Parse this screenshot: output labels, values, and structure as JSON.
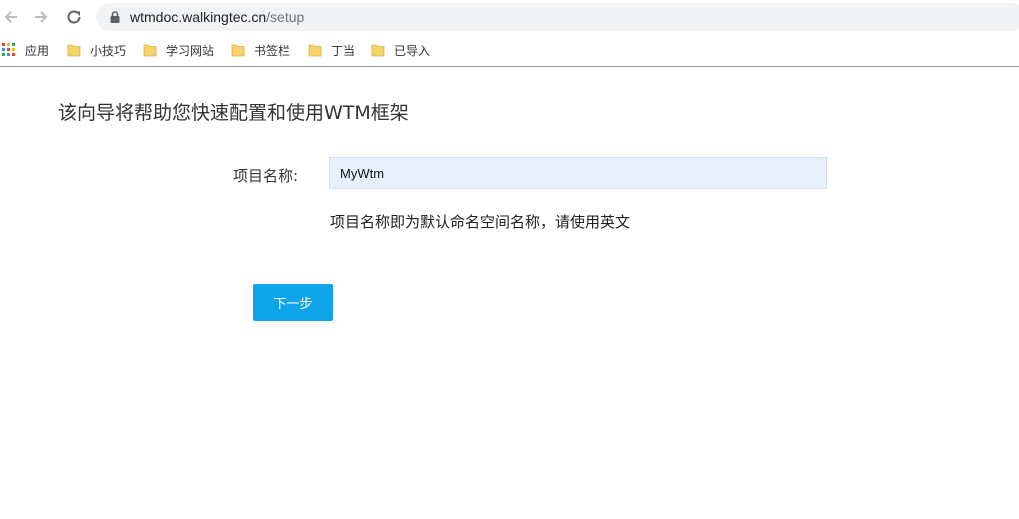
{
  "browser": {
    "url_host": "wtmdoc.walkingtec.cn",
    "url_path": "/setup",
    "bookmarks": [
      {
        "label": "应用",
        "icon": "apps-grid-icon"
      },
      {
        "label": "小技巧",
        "icon": "folder-icon"
      },
      {
        "label": "学习网站",
        "icon": "folder-icon"
      },
      {
        "label": "书签栏",
        "icon": "folder-icon"
      },
      {
        "label": "丁当",
        "icon": "folder-icon"
      },
      {
        "label": "已导入",
        "icon": "folder-icon"
      }
    ]
  },
  "setup": {
    "heading": "该向导将帮助您快速配置和使用WTM框架",
    "project_name_label": "项目名称:",
    "project_name_value": "MyWtm",
    "hint": "项目名称即为默认命名空间名称，请使用英文",
    "next_button": "下一步"
  },
  "colors": {
    "accent": "#0ea5e9",
    "input_bg": "#e8f0fe",
    "folder": "#f7d36b"
  }
}
